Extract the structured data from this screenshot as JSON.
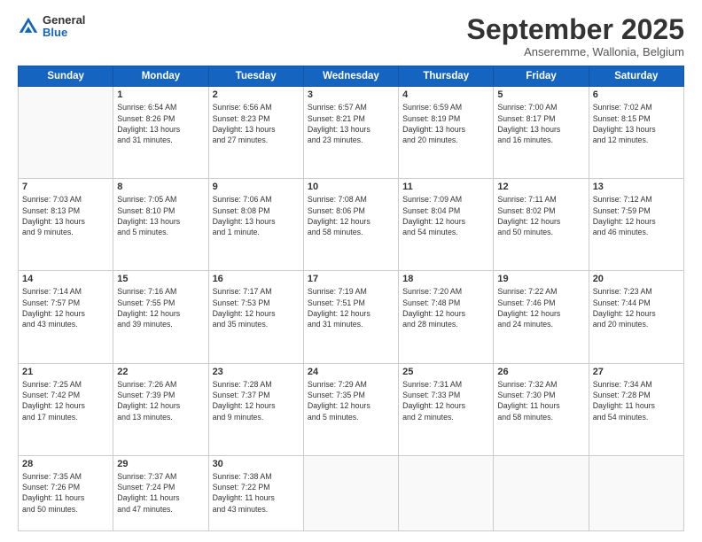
{
  "logo": {
    "general": "General",
    "blue": "Blue"
  },
  "header": {
    "month": "September 2025",
    "location": "Anseremme, Wallonia, Belgium"
  },
  "days_of_week": [
    "Sunday",
    "Monday",
    "Tuesday",
    "Wednesday",
    "Thursday",
    "Friday",
    "Saturday"
  ],
  "weeks": [
    [
      {
        "day": "",
        "info": ""
      },
      {
        "day": "1",
        "info": "Sunrise: 6:54 AM\nSunset: 8:26 PM\nDaylight: 13 hours\nand 31 minutes."
      },
      {
        "day": "2",
        "info": "Sunrise: 6:56 AM\nSunset: 8:23 PM\nDaylight: 13 hours\nand 27 minutes."
      },
      {
        "day": "3",
        "info": "Sunrise: 6:57 AM\nSunset: 8:21 PM\nDaylight: 13 hours\nand 23 minutes."
      },
      {
        "day": "4",
        "info": "Sunrise: 6:59 AM\nSunset: 8:19 PM\nDaylight: 13 hours\nand 20 minutes."
      },
      {
        "day": "5",
        "info": "Sunrise: 7:00 AM\nSunset: 8:17 PM\nDaylight: 13 hours\nand 16 minutes."
      },
      {
        "day": "6",
        "info": "Sunrise: 7:02 AM\nSunset: 8:15 PM\nDaylight: 13 hours\nand 12 minutes."
      }
    ],
    [
      {
        "day": "7",
        "info": "Sunrise: 7:03 AM\nSunset: 8:13 PM\nDaylight: 13 hours\nand 9 minutes."
      },
      {
        "day": "8",
        "info": "Sunrise: 7:05 AM\nSunset: 8:10 PM\nDaylight: 13 hours\nand 5 minutes."
      },
      {
        "day": "9",
        "info": "Sunrise: 7:06 AM\nSunset: 8:08 PM\nDaylight: 13 hours\nand 1 minute."
      },
      {
        "day": "10",
        "info": "Sunrise: 7:08 AM\nSunset: 8:06 PM\nDaylight: 12 hours\nand 58 minutes."
      },
      {
        "day": "11",
        "info": "Sunrise: 7:09 AM\nSunset: 8:04 PM\nDaylight: 12 hours\nand 54 minutes."
      },
      {
        "day": "12",
        "info": "Sunrise: 7:11 AM\nSunset: 8:02 PM\nDaylight: 12 hours\nand 50 minutes."
      },
      {
        "day": "13",
        "info": "Sunrise: 7:12 AM\nSunset: 7:59 PM\nDaylight: 12 hours\nand 46 minutes."
      }
    ],
    [
      {
        "day": "14",
        "info": "Sunrise: 7:14 AM\nSunset: 7:57 PM\nDaylight: 12 hours\nand 43 minutes."
      },
      {
        "day": "15",
        "info": "Sunrise: 7:16 AM\nSunset: 7:55 PM\nDaylight: 12 hours\nand 39 minutes."
      },
      {
        "day": "16",
        "info": "Sunrise: 7:17 AM\nSunset: 7:53 PM\nDaylight: 12 hours\nand 35 minutes."
      },
      {
        "day": "17",
        "info": "Sunrise: 7:19 AM\nSunset: 7:51 PM\nDaylight: 12 hours\nand 31 minutes."
      },
      {
        "day": "18",
        "info": "Sunrise: 7:20 AM\nSunset: 7:48 PM\nDaylight: 12 hours\nand 28 minutes."
      },
      {
        "day": "19",
        "info": "Sunrise: 7:22 AM\nSunset: 7:46 PM\nDaylight: 12 hours\nand 24 minutes."
      },
      {
        "day": "20",
        "info": "Sunrise: 7:23 AM\nSunset: 7:44 PM\nDaylight: 12 hours\nand 20 minutes."
      }
    ],
    [
      {
        "day": "21",
        "info": "Sunrise: 7:25 AM\nSunset: 7:42 PM\nDaylight: 12 hours\nand 17 minutes."
      },
      {
        "day": "22",
        "info": "Sunrise: 7:26 AM\nSunset: 7:39 PM\nDaylight: 12 hours\nand 13 minutes."
      },
      {
        "day": "23",
        "info": "Sunrise: 7:28 AM\nSunset: 7:37 PM\nDaylight: 12 hours\nand 9 minutes."
      },
      {
        "day": "24",
        "info": "Sunrise: 7:29 AM\nSunset: 7:35 PM\nDaylight: 12 hours\nand 5 minutes."
      },
      {
        "day": "25",
        "info": "Sunrise: 7:31 AM\nSunset: 7:33 PM\nDaylight: 12 hours\nand 2 minutes."
      },
      {
        "day": "26",
        "info": "Sunrise: 7:32 AM\nSunset: 7:30 PM\nDaylight: 11 hours\nand 58 minutes."
      },
      {
        "day": "27",
        "info": "Sunrise: 7:34 AM\nSunset: 7:28 PM\nDaylight: 11 hours\nand 54 minutes."
      }
    ],
    [
      {
        "day": "28",
        "info": "Sunrise: 7:35 AM\nSunset: 7:26 PM\nDaylight: 11 hours\nand 50 minutes."
      },
      {
        "day": "29",
        "info": "Sunrise: 7:37 AM\nSunset: 7:24 PM\nDaylight: 11 hours\nand 47 minutes."
      },
      {
        "day": "30",
        "info": "Sunrise: 7:38 AM\nSunset: 7:22 PM\nDaylight: 11 hours\nand 43 minutes."
      },
      {
        "day": "",
        "info": ""
      },
      {
        "day": "",
        "info": ""
      },
      {
        "day": "",
        "info": ""
      },
      {
        "day": "",
        "info": ""
      }
    ]
  ]
}
